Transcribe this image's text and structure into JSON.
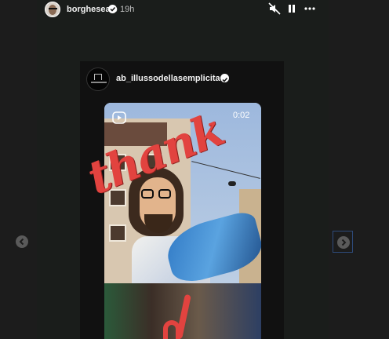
{
  "story": {
    "username": "borgheseale",
    "time": "19h",
    "controls": {
      "mute": "speaker-muted-icon",
      "pause": "pause-icon",
      "more": "more-icon"
    }
  },
  "shared_post": {
    "username": "ab_illussodellasemplicita",
    "video_time": "0:02"
  },
  "sticker_text": "thank",
  "navigation": {
    "prev": "chevron-left-icon",
    "next": "chevron-right-icon"
  },
  "colors": {
    "background": "#1c1c1c",
    "story_bg": "#1a1d1b",
    "sticker_red": "#e2433f"
  }
}
